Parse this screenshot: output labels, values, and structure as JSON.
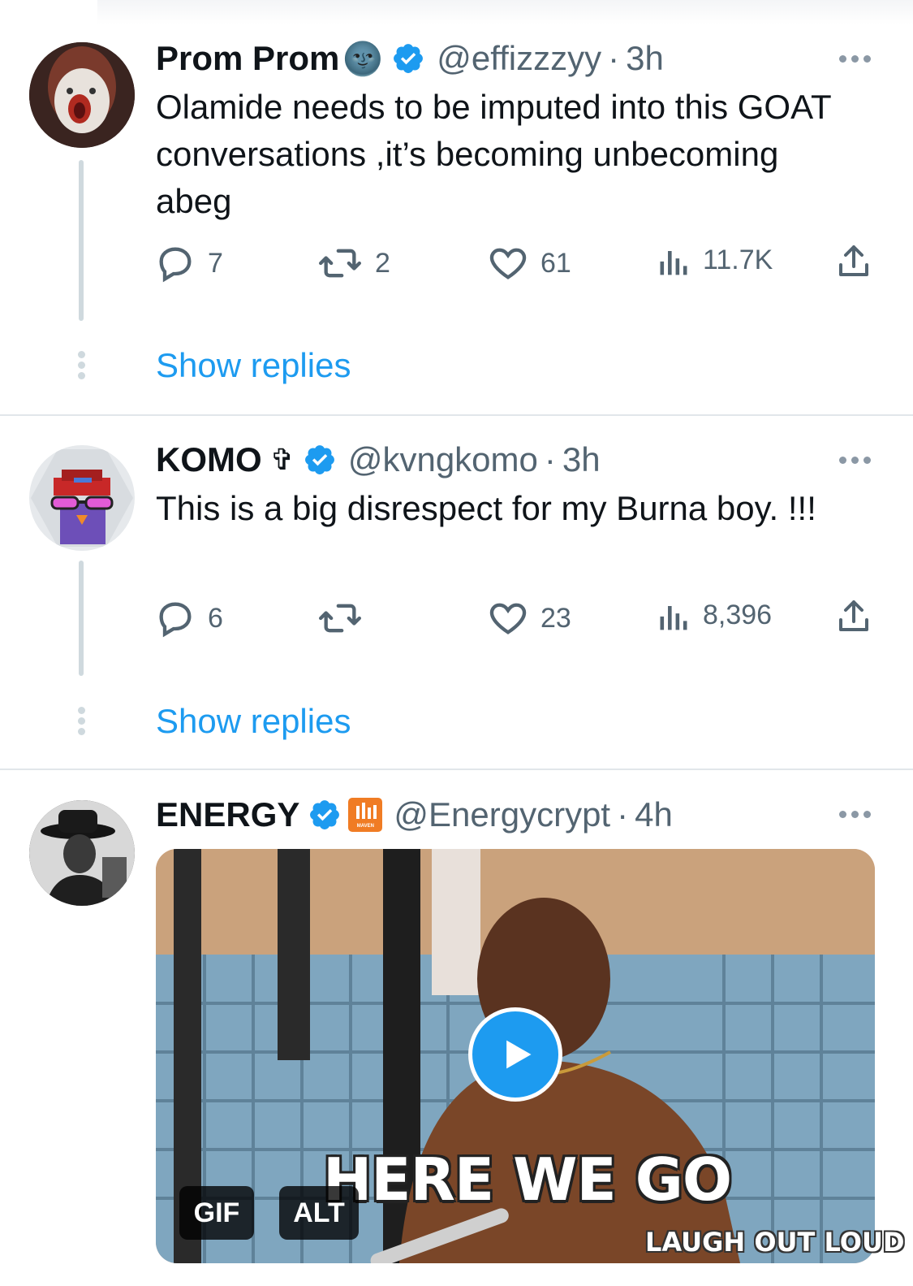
{
  "tweets": [
    {
      "name": "Prom Prom",
      "emoji": "🌚",
      "handle": "@effizzzyy",
      "separator": "·",
      "time": "3h",
      "text": "Olamide needs to be imputed into this GOAT conversations ,it’s becoming unbecoming abeg",
      "replies": "7",
      "retweets": "2",
      "likes": "61",
      "views": "11.7K",
      "show_replies": "Show replies"
    },
    {
      "name": "KOMO",
      "emoji": "✞",
      "handle": "@kvngkomo",
      "separator": "·",
      "time": "3h",
      "text": "This is a big disrespect for my Burna boy. !!!",
      "replies": "6",
      "retweets": "",
      "likes": "23",
      "views": "8,396",
      "show_replies": "Show replies"
    },
    {
      "name": "ENERGY",
      "handle": "@Energycrypt",
      "separator": "·",
      "time": "4h",
      "affiliate_badge": "MAVEN",
      "media": {
        "caption": "HERE WE GO",
        "watermark": "LAUGH OUT LOUD",
        "badge_gif": "GIF",
        "badge_alt": "ALT"
      }
    }
  ],
  "colors": {
    "accent": "#1d9bf0",
    "text_primary": "#0f1419",
    "text_secondary": "#536471",
    "divider": "#e1e6ea",
    "thread_line": "#cfd9de"
  },
  "icons": [
    "verified-badge-icon",
    "more-icon",
    "reply-icon",
    "retweet-icon",
    "like-icon",
    "views-icon",
    "share-icon",
    "play-icon"
  ]
}
